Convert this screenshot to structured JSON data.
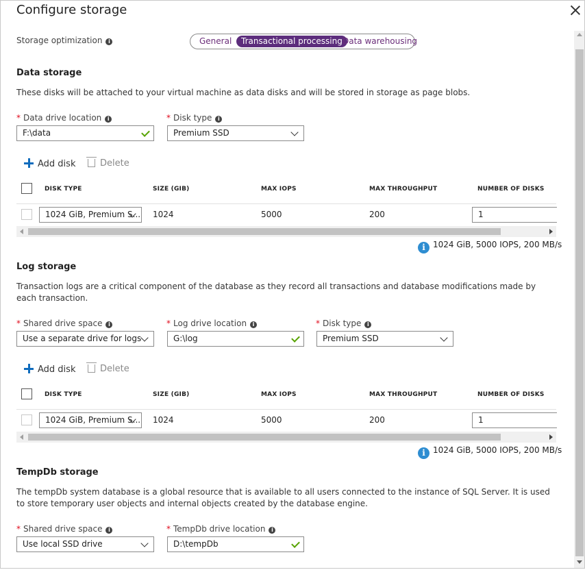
{
  "window": {
    "title": "Configure storage"
  },
  "optimization": {
    "label": "Storage optimization",
    "options": [
      "General",
      "Transactional processing",
      "Data warehousing"
    ],
    "selected": "Transactional processing"
  },
  "data_storage": {
    "heading": "Data storage",
    "description": "These disks will be attached to your virtual machine as data disks and will be stored in storage as page blobs.",
    "location_label": "Data drive location",
    "location_value": "F:\\data",
    "disk_type_label": "Disk type",
    "disk_type_value": "Premium SSD",
    "add_disk": "Add disk",
    "delete": "Delete",
    "columns": [
      "DISK TYPE",
      "SIZE (GIB)",
      "MAX IOPS",
      "MAX THROUGHPUT",
      "NUMBER OF DISKS"
    ],
    "row": {
      "disk_type": "1024 GiB, Premium S...",
      "size": "1024",
      "iops": "5000",
      "throughput": "200",
      "count": "1"
    },
    "summary": "1024 GiB, 5000 IOPS, 200 MB/s"
  },
  "log_storage": {
    "heading": "Log storage",
    "description": "Transaction logs are a critical component of the database as they record all transactions and database modifications made by each transaction.",
    "shared_label": "Shared drive space",
    "shared_value": "Use a separate drive for logs",
    "location_label": "Log drive location",
    "location_value": "G:\\log",
    "disk_type_label": "Disk type",
    "disk_type_value": "Premium SSD",
    "add_disk": "Add disk",
    "delete": "Delete",
    "columns": [
      "DISK TYPE",
      "SIZE (GIB)",
      "MAX IOPS",
      "MAX THROUGHPUT",
      "NUMBER OF DISKS"
    ],
    "row": {
      "disk_type": "1024 GiB, Premium S...",
      "size": "1024",
      "iops": "5000",
      "throughput": "200",
      "count": "1"
    },
    "summary": "1024 GiB, 5000 IOPS, 200 MB/s"
  },
  "tempdb_storage": {
    "heading": "TempDb storage",
    "description": "The tempDb system database is a global resource that is available to all users connected to the instance of SQL Server. It is used to store temporary user objects and internal objects created by the database engine.",
    "shared_label": "Shared drive space",
    "shared_value": "Use local SSD drive",
    "location_label": "TempDb drive location",
    "location_value": "D:\\tempDb"
  },
  "icons": {
    "info": "info-icon",
    "close": "close-icon",
    "add": "plus-icon",
    "delete": "trash-icon",
    "valid": "checkmark-icon",
    "dropdown": "chevron-down-icon"
  },
  "colors": {
    "accent": "#5c2d7c",
    "required": "#e00b1c",
    "valid": "#57a300",
    "add_icon": "#0f6cbd",
    "info_badge": "#2e8dd1"
  }
}
